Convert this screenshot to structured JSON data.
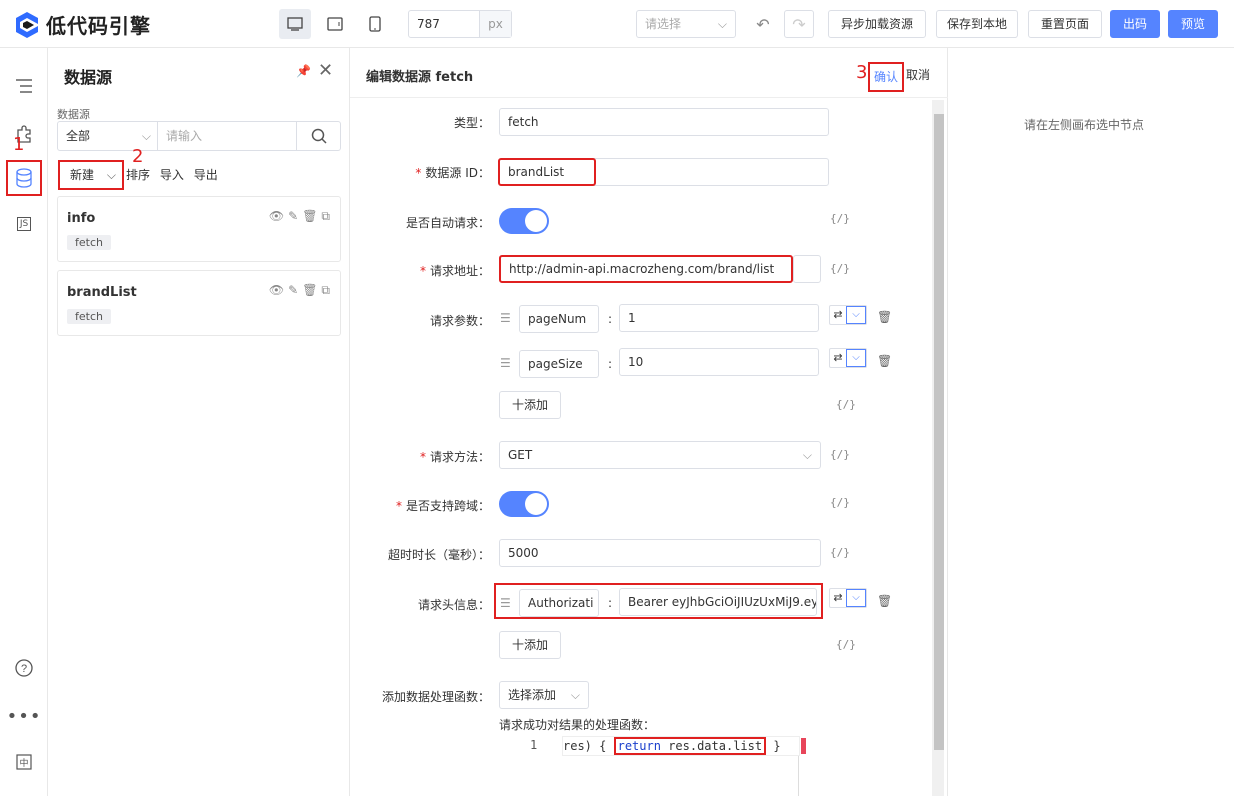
{
  "topbar": {
    "logo_text": "低代码引擎",
    "device_icons": [
      "desktop-icon",
      "tablet-icon",
      "phone-icon"
    ],
    "width_value": "787",
    "width_unit": "px",
    "select_placeholder": "请选择",
    "buttons": {
      "async_load": "异步加载资源",
      "save_local": "保存到本地",
      "reset_page": "重置页面",
      "export_code": "出码",
      "preview": "预览"
    },
    "accent": "#5584ff"
  },
  "iconbar": {
    "marks": {
      "one": "1",
      "two": "2",
      "three": "3"
    },
    "js_label": "JS"
  },
  "datasource_panel": {
    "title": "数据源",
    "filter_label": "数据源",
    "filter_select": "全部",
    "filter_placeholder": "请输入",
    "new_label": "新建",
    "actions": [
      "排序",
      "导入",
      "导出"
    ],
    "items": [
      {
        "name": "info",
        "type": "fetch"
      },
      {
        "name": "brandList",
        "type": "fetch"
      }
    ]
  },
  "editor": {
    "title": "编辑数据源 fetch",
    "confirm": "确认",
    "cancel": "取消",
    "fields": {
      "type_label": "类型",
      "type_value": "fetch",
      "id_label": "数据源 ID",
      "id_value": "brandList",
      "auto_label": "是否自动请求",
      "url_label": "请求地址",
      "url_value": "http://admin-api.macrozheng.com/brand/list",
      "params_label": "请求参数",
      "params": [
        {
          "key": "pageNum",
          "value": "1"
        },
        {
          "key": "pageSize",
          "value": "10"
        }
      ],
      "add_label": "十添加",
      "method_label": "请求方法",
      "method_value": "GET",
      "cors_label": "是否支持跨域",
      "timeout_label": "超时时长（毫秒）",
      "timeout_value": "5000",
      "headers_label": "请求头信息",
      "header_key": "Authorizati",
      "header_value": "Bearer eyJhbGciOiJIUzUxMiJ9.ey",
      "handler_label": "添加数据处理函数",
      "handler_select": "选择添加",
      "success_label": "请求成功对结果的处理函数：",
      "code_line_no": "1",
      "code_prefix": "res) {",
      "code_keyword": "return",
      "code_body": "res.data.list",
      "code_suffix": "}",
      "curly": "{/}"
    }
  },
  "right_panel": {
    "hint": "请在左侧画布选中节点"
  }
}
